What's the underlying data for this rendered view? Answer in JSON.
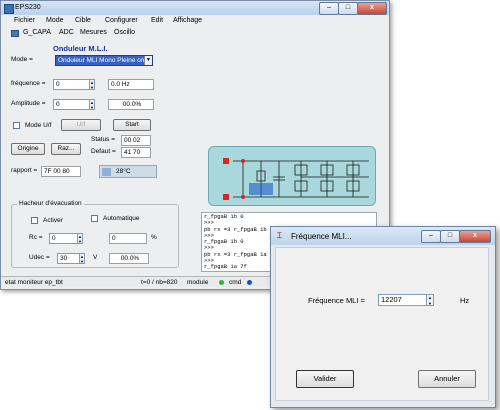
{
  "app": {
    "title": "EPS230",
    "menu": [
      "Fichier",
      "Mode",
      "Cible",
      "Configurer",
      "Edit",
      "Affichage"
    ],
    "toolbar": [
      "G_CAPA",
      "ADC",
      "Mesures",
      "Oscillo"
    ]
  },
  "main": {
    "heading": "Onduleur M.L.I.",
    "mode_label": "Mode =",
    "mode_value": "Onduleur MLI Mono Pleine onde",
    "freq_label": "fréquence =",
    "freq_value": "0",
    "freq_hz": "0.0 Hz",
    "ampl_label": "Amplitude =",
    "ampl_value": "0",
    "ampl_pct": "00.0%",
    "mode_uf_label": "Mode U/f",
    "uf_button": "U/f",
    "start_button": "Start",
    "status_label": "Status =",
    "status_value": "00 02",
    "defaut_label": "Defaut =",
    "defaut_value": "41 70",
    "origine_button": "Origine",
    "raz_button": "Raz...",
    "rapport_label": "rapport =",
    "rapport_value": "7F 00 80",
    "temp_value": "28°C"
  },
  "hacheur": {
    "legend": "Hacheur d'évacuation",
    "activer_label": "Activer",
    "auto_label": "Automatique",
    "rc_label": "Rc =",
    "rc_value": "0",
    "rc_pct_value": "0",
    "rc_pct_unit": "%",
    "udec_label": "Udec =",
    "udec_value": "30",
    "udec_unit": "V",
    "udec_pct": "00.0%"
  },
  "log": {
    "lines": [
      "r_fpgaB 1b 0",
      ">>>",
      "pb rx =3 r_fpgaB 1b 0",
      ">>>",
      "r_fpgaB 1b 0",
      ">>>",
      "pb rx =3 r_fpgaB 1a 7f",
      ">>>",
      "r_fpgaB 1a 7f"
    ]
  },
  "statusbar": {
    "left": "etat moniteur ep_tbt",
    "middle": "t=0 / nb=820",
    "module": "module",
    "cmd": "cmd"
  },
  "dialog": {
    "title": "Fréquence MLI...",
    "label": "Fréquence MLI =",
    "value": "12207",
    "unit": "Hz",
    "ok_button": "Valider",
    "cancel_button": "Annuler"
  }
}
